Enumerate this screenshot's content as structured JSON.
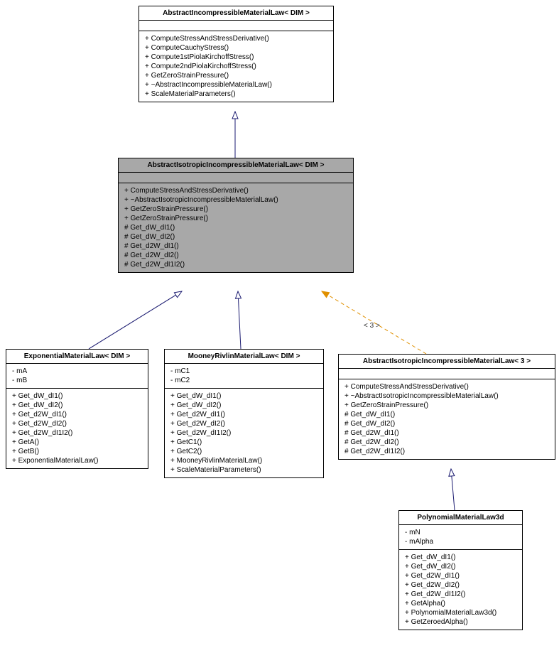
{
  "chart_data": {
    "type": "uml_class_diagram",
    "classes": [
      {
        "id": "abstract-incompressible",
        "name": "AbstractIncompressibleMaterialLaw< DIM >",
        "attrs": [],
        "methods": [
          "+ ComputeStressAndStressDerivative()",
          "+ ComputeCauchyStress()",
          "+ Compute1stPiolaKirchoffStress()",
          "+ Compute2ndPiolaKirchoffStress()",
          "+ GetZeroStrainPressure()",
          "+ ~AbstractIncompressibleMaterialLaw()",
          "+ ScaleMaterialParameters()"
        ]
      },
      {
        "id": "abstract-isotropic",
        "name": "AbstractIsotropicIncompressibleMaterialLaw< DIM >",
        "attrs": [],
        "methods": [
          "+ ComputeStressAndStressDerivative()",
          "+ ~AbstractIsotropicIncompressibleMaterialLaw()",
          "+ GetZeroStrainPressure()",
          "+ GetZeroStrainPressure()",
          "# Get_dW_dI1()",
          "# Get_dW_dI2()",
          "# Get_d2W_dI1()",
          "# Get_d2W_dI2()",
          "# Get_d2W_dI1I2()"
        ]
      },
      {
        "id": "exponential",
        "name": "ExponentialMaterialLaw< DIM >",
        "attrs": [
          "- mA",
          "- mB"
        ],
        "methods": [
          "+ Get_dW_dI1()",
          "+ Get_dW_dI2()",
          "+ Get_d2W_dI1()",
          "+ Get_d2W_dI2()",
          "+ Get_d2W_dI1I2()",
          "+ GetA()",
          "+ GetB()",
          "+ ExponentialMaterialLaw()"
        ]
      },
      {
        "id": "mooney",
        "name": "MooneyRivlinMaterialLaw< DIM >",
        "attrs": [
          "- mC1",
          "- mC2"
        ],
        "methods": [
          "+ Get_dW_dI1()",
          "+ Get_dW_dI2()",
          "+ Get_d2W_dI1()",
          "+ Get_d2W_dI2()",
          "+ Get_d2W_dI1I2()",
          "+ GetC1()",
          "+ GetC2()",
          "+ MooneyRivlinMaterialLaw()",
          "+ ScaleMaterialParameters()"
        ]
      },
      {
        "id": "abstract-isotropic-3",
        "name": "AbstractIsotropicIncompressibleMaterialLaw< 3 >",
        "attrs": [],
        "methods": [
          "+ ComputeStressAndStressDerivative()",
          "+ ~AbstractIsotropicIncompressibleMaterialLaw()",
          "+ GetZeroStrainPressure()",
          "# Get_dW_dI1()",
          "# Get_dW_dI2()",
          "# Get_d2W_dI1()",
          "# Get_d2W_dI2()",
          "# Get_d2W_dI1I2()"
        ]
      },
      {
        "id": "polynomial",
        "name": "PolynomialMaterialLaw3d",
        "attrs": [
          "- mN",
          "- mAlpha"
        ],
        "methods": [
          "+ Get_dW_dI1()",
          "+ Get_dW_dI2()",
          "+ Get_d2W_dI1()",
          "+ Get_d2W_dI2()",
          "+ Get_d2W_dI1I2()",
          "+ GetAlpha()",
          "+ PolynomialMaterialLaw3d()",
          "+ GetZeroedAlpha()"
        ]
      }
    ],
    "edges": [
      {
        "from": "abstract-isotropic",
        "to": "abstract-incompressible",
        "style": "solid",
        "color": "#1a1a70",
        "label": null,
        "type": "generalization"
      },
      {
        "from": "exponential",
        "to": "abstract-isotropic",
        "style": "solid",
        "color": "#1a1a70",
        "label": null,
        "type": "generalization"
      },
      {
        "from": "mooney",
        "to": "abstract-isotropic",
        "style": "solid",
        "color": "#1a1a70",
        "label": null,
        "type": "generalization"
      },
      {
        "from": "abstract-isotropic-3",
        "to": "abstract-isotropic",
        "style": "dashed",
        "color": "#e09000",
        "label": "< 3 >",
        "type": "template-bind"
      },
      {
        "from": "polynomial",
        "to": "abstract-isotropic-3",
        "style": "solid",
        "color": "#1a1a70",
        "label": null,
        "type": "generalization"
      }
    ],
    "edge_label": "< 3 >"
  }
}
